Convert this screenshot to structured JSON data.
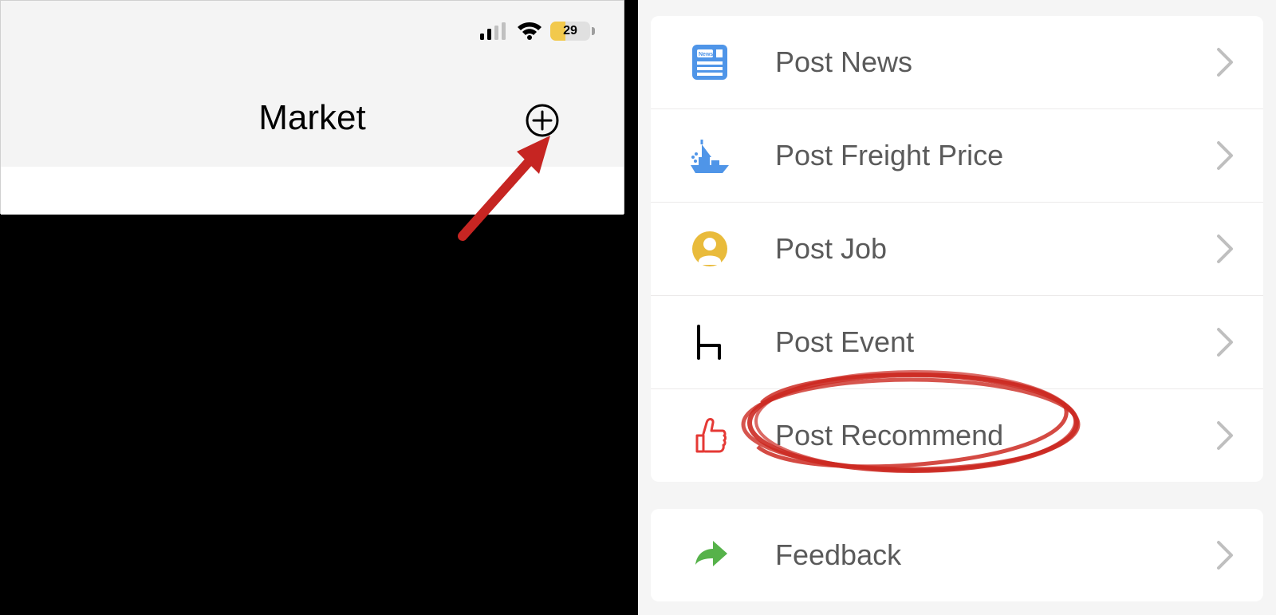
{
  "statusbar": {
    "battery_level": "29"
  },
  "left": {
    "title": "Market"
  },
  "menu": {
    "items": [
      {
        "label": "Post News"
      },
      {
        "label": "Post Freight Price"
      },
      {
        "label": "Post Job"
      },
      {
        "label": "Post Event"
      },
      {
        "label": "Post Recommend"
      }
    ],
    "feedback_label": "Feedback"
  }
}
